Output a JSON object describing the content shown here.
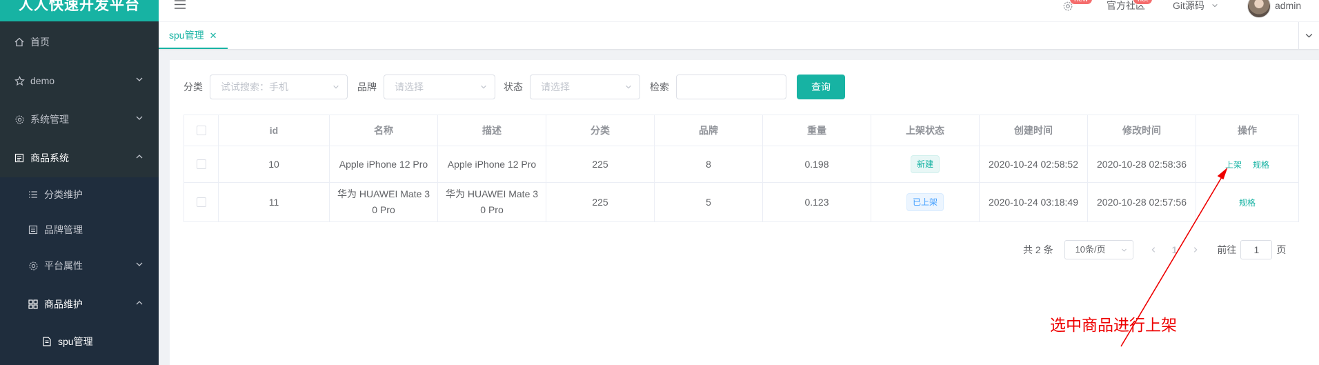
{
  "brand": "人人快速开发平台",
  "sidebar": {
    "items": [
      {
        "label": "首页",
        "icon": "home-icon"
      },
      {
        "label": "demo",
        "icon": "star-icon"
      },
      {
        "label": "系统管理",
        "icon": "gear-icon"
      },
      {
        "label": "商品系统",
        "icon": "goods-icon"
      },
      {
        "label": "分类维护",
        "icon": "list-icon"
      },
      {
        "label": "品牌管理",
        "icon": "brand-icon"
      },
      {
        "label": "平台属性",
        "icon": "gear-icon"
      },
      {
        "label": "商品维护",
        "icon": "grid-icon"
      },
      {
        "label": "spu管理",
        "icon": "doc-icon"
      }
    ]
  },
  "topbar": {
    "settings_badge": "new",
    "community": "官方社区",
    "community_badge": "hot",
    "git": "Git源码",
    "user": "admin"
  },
  "tabs": [
    {
      "label": "spu管理"
    }
  ],
  "search": {
    "category_label": "分类",
    "category_placeholder": "试试搜索：手机",
    "brand_label": "品牌",
    "brand_placeholder": "请选择",
    "status_label": "状态",
    "status_placeholder": "请选择",
    "keyword_label": "检索",
    "query_button": "查询"
  },
  "table": {
    "headers": [
      "id",
      "名称",
      "描述",
      "分类",
      "品牌",
      "重量",
      "上架状态",
      "创建时间",
      "修改时间",
      "操作"
    ],
    "rows": [
      {
        "id": "10",
        "name": "Apple iPhone 12 Pro",
        "desc": "Apple iPhone 12 Pro",
        "category": "225",
        "brand": "8",
        "weight": "0.198",
        "status": "新建",
        "created": "2020-10-24 02:58:52",
        "modified": "2020-10-28 02:58:36",
        "ops": [
          "上架",
          "规格"
        ]
      },
      {
        "id": "11",
        "name_line1": "华为 HUAWEI Mate 3",
        "name_line2": "0 Pro",
        "desc_line1": "华为 HUAWEI Mate 3",
        "desc_line2": "0 Pro",
        "category": "225",
        "brand": "5",
        "weight": "0.123",
        "status": "已上架",
        "created": "2020-10-24 03:18:49",
        "modified": "2020-10-28 02:57:56",
        "ops": [
          "规格"
        ]
      }
    ]
  },
  "pagination": {
    "total": "共 2 条",
    "page_size": "10条/页",
    "current_page": "1",
    "goto_label": "前往",
    "goto_value": "1",
    "page_suffix": "页"
  },
  "annotation": "选中商品进行上架",
  "colors": {
    "accent": "#17b3a3",
    "sidebar": "#263238",
    "annotation": "#ee0000"
  }
}
